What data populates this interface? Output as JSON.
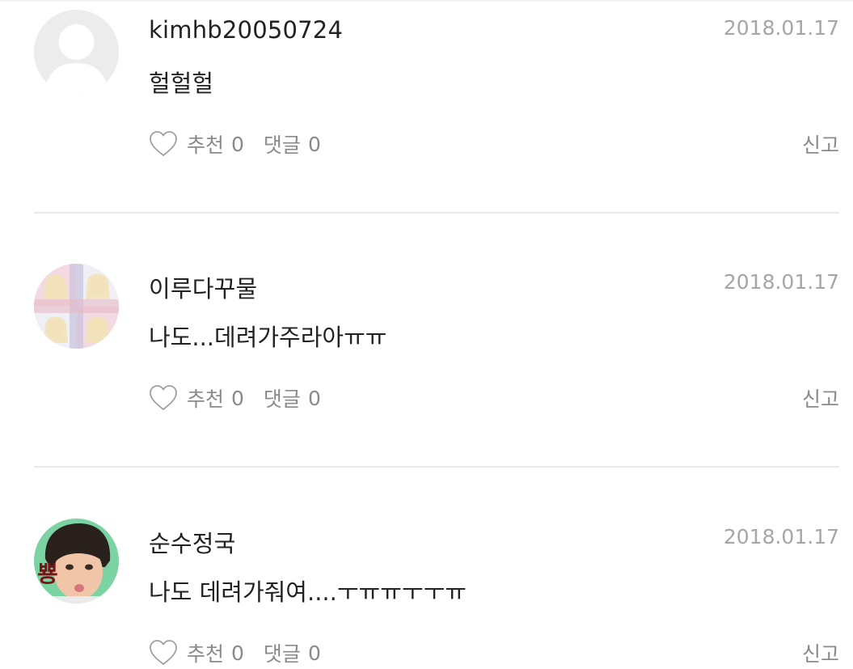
{
  "comments": [
    {
      "username": "kimhb20050724",
      "date": "2018.01.17",
      "text": "헐헐헐",
      "like_label": "추천",
      "like_count": "0",
      "reply_label": "댓글",
      "reply_count": "0",
      "report_label": "신고",
      "avatar": "default-avatar"
    },
    {
      "username": "이루다꾸물",
      "date": "2018.01.17",
      "text": "나도...데려가주라아ㅠㅠ",
      "like_label": "추천",
      "like_count": "0",
      "reply_label": "댓글",
      "reply_count": "0",
      "report_label": "신고",
      "avatar": "photo-collage-avatar"
    },
    {
      "username": "순수정국",
      "date": "2018.01.17",
      "text": "나도 데려가줘여....ㅜㅠㅠㅜㅜㅠ",
      "like_label": "추천",
      "like_count": "0",
      "reply_label": "댓글",
      "reply_count": "0",
      "report_label": "신고",
      "avatar": "face-photo-avatar",
      "avatar_overlay_text": "뿅"
    }
  ],
  "colors": {
    "text": "#222222",
    "muted": "#8a8a8a",
    "date": "#a6a6a6",
    "divider": "#e9e9e9"
  }
}
